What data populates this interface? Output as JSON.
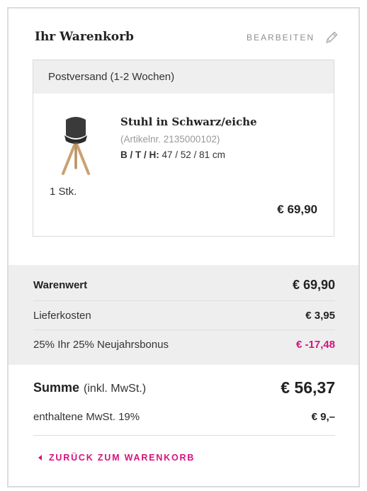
{
  "cart": {
    "title": "Ihr Warenkorb",
    "edit_label": "BEARBEITEN"
  },
  "shipment": {
    "heading": "Postversand (1-2 Wochen)",
    "item": {
      "name": "Stuhl in Schwarz/eiche",
      "article_no": "(Artikelnr. 2135000102)",
      "dims_label": "B / T / H:",
      "dims_value": "47 / 52 / 81 cm",
      "quantity": "1 Stk.",
      "price": "€ 69,90",
      "image_icon": "chair-image"
    }
  },
  "totals": {
    "goods_label": "Warenwert",
    "goods_value": "€ 69,90",
    "shipping_label": "Lieferkosten",
    "shipping_value": "€ 3,95",
    "discount_label": "25% Ihr 25% Neujahrsbonus",
    "discount_value": "€ -17,48"
  },
  "summary": {
    "sum_label": "Summe",
    "sum_sub": "(inkl. MwSt.)",
    "sum_value": "€ 56,37",
    "vat_label": "enthaltene MwSt. 19%",
    "vat_value": "€ 9,–"
  },
  "back_link": {
    "label": "ZURÜCK ZUM WARENKORB"
  },
  "colors": {
    "accent": "#d6127e",
    "panel_bg": "#eeeeee",
    "border": "#dcdcdc"
  }
}
